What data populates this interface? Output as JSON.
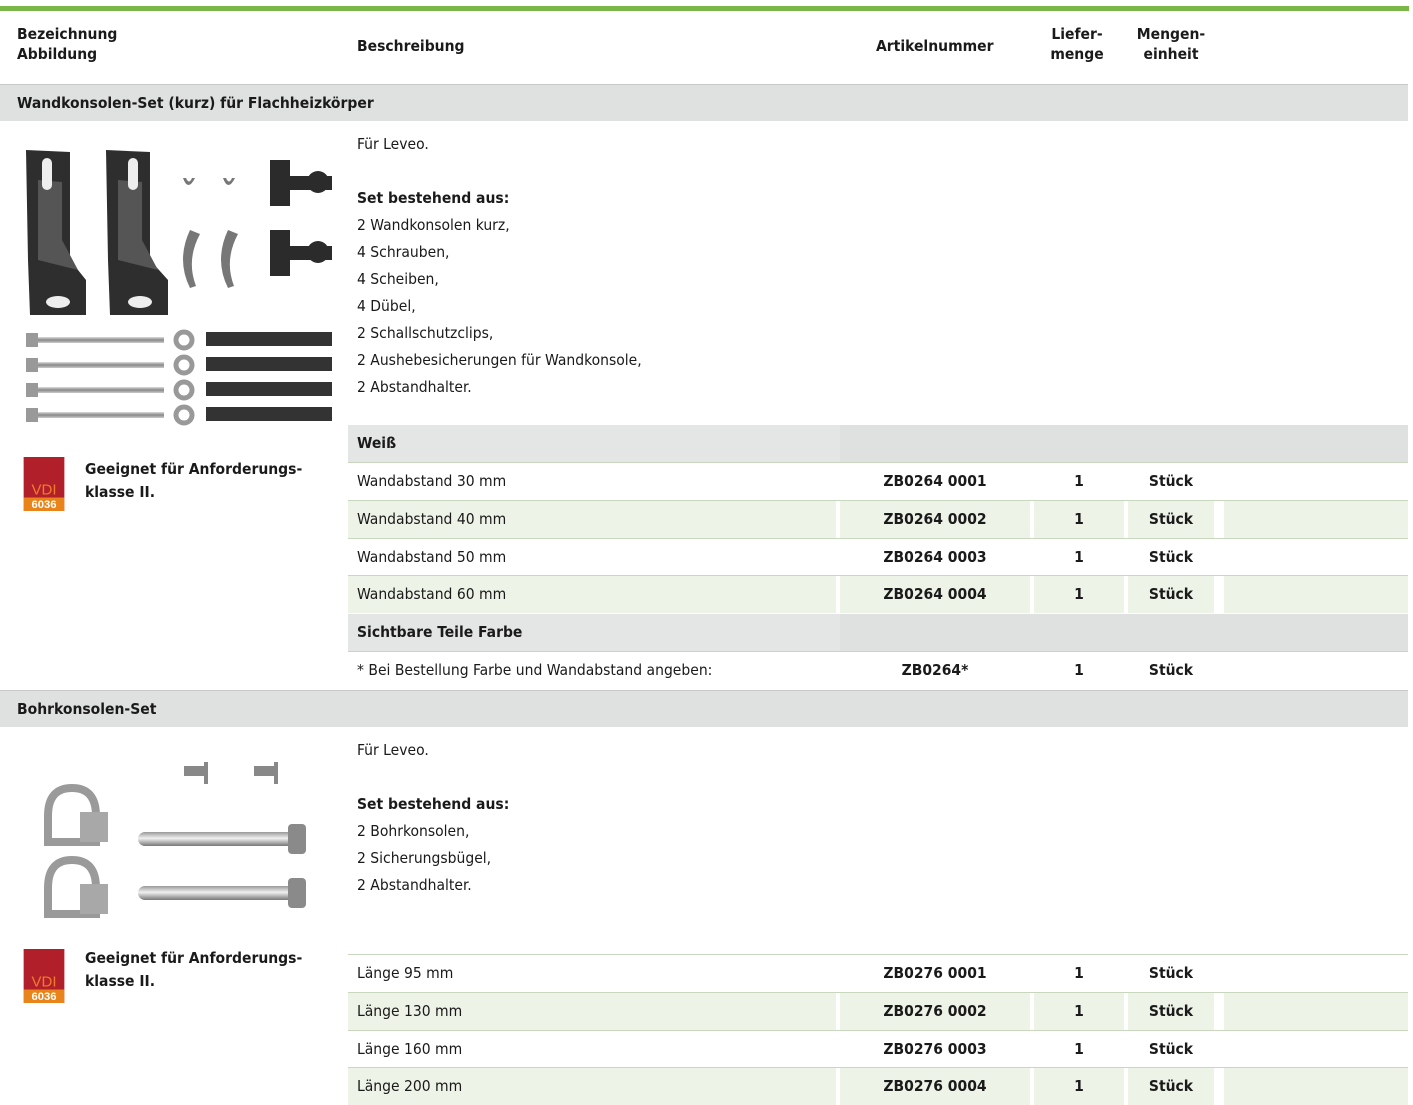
{
  "header": {
    "col1_line1": "Bezeichnung",
    "col1_line2": "Abbildung",
    "col2": "Beschreibung",
    "col3": "Artikelnummer",
    "col4_line1": "Liefer-",
    "col4_line2": "menge",
    "col5_line1": "Mengen-",
    "col5_line2": "einheit"
  },
  "sections": [
    {
      "title": "Wandkonsolen-Set (kurz) für Flachheizkörper",
      "intro": "Für Leveo.",
      "set_heading": "Set bestehend aus:",
      "set_items": [
        "2 Wandkonsolen kurz,",
        "4 Schrauben,",
        "4 Scheiben,",
        "4 Dübel,",
        "2 Schallschutzclips,",
        "2 Aushebesicherungen für Wandkonsole,",
        "2 Abstandhalter."
      ],
      "vdi_top": "VDI",
      "vdi_bottom": "6036",
      "vdi_note_line1": "Geeignet für Anforderungs-",
      "vdi_note_line2": "klasse II.",
      "subgroups": [
        {
          "label": "Weiß",
          "rows": [
            {
              "desc": "Wandabstand 30 mm",
              "article": "ZB0264 0001",
              "qty": "1",
              "unit": "Stück"
            },
            {
              "desc": "Wandabstand 40 mm",
              "article": "ZB0264 0002",
              "qty": "1",
              "unit": "Stück"
            },
            {
              "desc": "Wandabstand 50 mm",
              "article": "ZB0264 0003",
              "qty": "1",
              "unit": "Stück"
            },
            {
              "desc": "Wandabstand 60 mm",
              "article": "ZB0264 0004",
              "qty": "1",
              "unit": "Stück"
            }
          ]
        },
        {
          "label": "Sichtbare Teile Farbe",
          "rows": [
            {
              "desc": "* Bei Bestellung Farbe und Wandabstand  angeben:",
              "article": "ZB0264*",
              "qty": "1",
              "unit": "Stück"
            }
          ]
        }
      ]
    },
    {
      "title": "Bohrkonsolen-Set",
      "intro": "Für Leveo.",
      "set_heading": "Set bestehend aus:",
      "set_items": [
        "2 Bohrkonsolen,",
        "2 Sicherungsbügel,",
        "2 Abstandhalter."
      ],
      "vdi_top": "VDI",
      "vdi_bottom": "6036",
      "vdi_note_line1": "Geeignet für Anforderungs-",
      "vdi_note_line2": "klasse II.",
      "rows": [
        {
          "desc": "Länge 95 mm",
          "article": "ZB0276 0001",
          "qty": "1",
          "unit": "Stück"
        },
        {
          "desc": "Länge 130 mm",
          "article": "ZB0276 0002",
          "qty": "1",
          "unit": "Stück"
        },
        {
          "desc": "Länge 160 mm",
          "article": "ZB0276 0003",
          "qty": "1",
          "unit": "Stück"
        },
        {
          "desc": "Länge 200 mm",
          "article": "ZB0276 0004",
          "qty": "1",
          "unit": "Stück"
        }
      ]
    }
  ],
  "colors": {
    "accent_green": "#7ab648",
    "vdi_red": "#c0282d",
    "vdi_orange": "#e8841a",
    "row_alt": "#eef3e8",
    "section_gray": "#dfe0e0"
  }
}
